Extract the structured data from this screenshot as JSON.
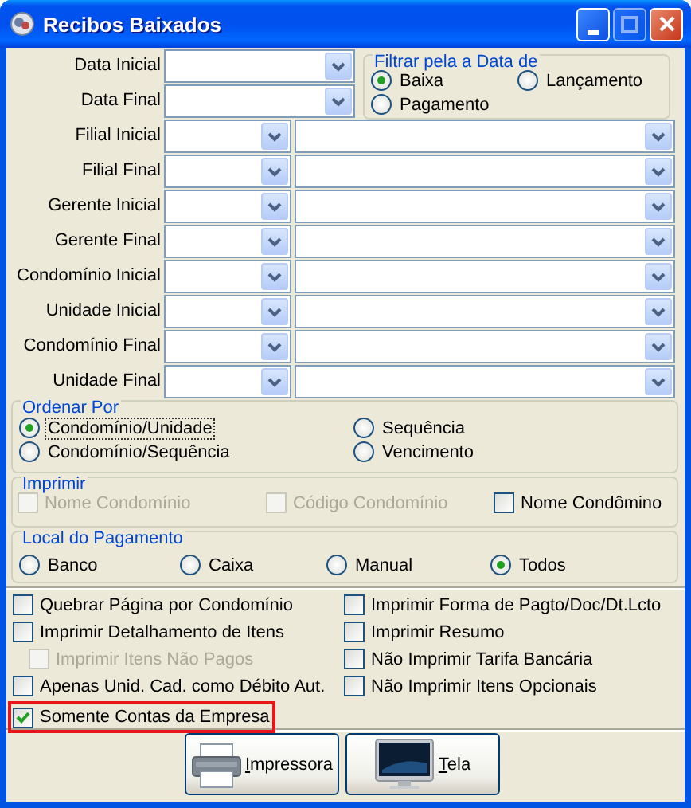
{
  "window": {
    "title": "Recibos Baixados"
  },
  "date_fields": [
    {
      "label": "Data Inicial"
    },
    {
      "label": "Data Final"
    }
  ],
  "date_filter": {
    "title": "Filtrar pela a Data de",
    "options": [
      {
        "label": "Baixa",
        "selected": true
      },
      {
        "label": "Lançamento",
        "selected": false
      },
      {
        "label": "Pagamento",
        "selected": false
      }
    ]
  },
  "range_fields": [
    {
      "label": "Filial Inicial"
    },
    {
      "label": "Filial Final"
    },
    {
      "label": "Gerente Inicial"
    },
    {
      "label": "Gerente Final"
    },
    {
      "label": "Condomínio Inicial"
    },
    {
      "label": "Unidade Inicial"
    },
    {
      "label": "Condomínio Final"
    },
    {
      "label": "Unidade Final"
    }
  ],
  "sort": {
    "title": "Ordenar Por",
    "options": [
      {
        "label": "Condomínio/Unidade",
        "selected": true,
        "focused": true
      },
      {
        "label": "Sequência",
        "selected": false,
        "focused": false
      },
      {
        "label": "Condomínio/Sequência",
        "selected": false,
        "focused": false
      },
      {
        "label": "Vencimento",
        "selected": false,
        "focused": false
      }
    ]
  },
  "print": {
    "title": "Imprimir",
    "options": [
      {
        "label": "Nome Condomínio",
        "checked": false,
        "disabled": true
      },
      {
        "label": "Código Condomínio",
        "checked": false,
        "disabled": true
      },
      {
        "label": "Nome Condômino",
        "checked": false,
        "disabled": false
      }
    ]
  },
  "payment_location": {
    "title": "Local do Pagamento",
    "options": [
      {
        "label": "Banco",
        "selected": false
      },
      {
        "label": "Caixa",
        "selected": false
      },
      {
        "label": "Manual",
        "selected": false
      },
      {
        "label": "Todos",
        "selected": true
      }
    ]
  },
  "options_left": [
    {
      "label": "Quebrar Página por Condomínio",
      "checked": false,
      "disabled": false,
      "highlighted": false
    },
    {
      "label": "Imprimir Detalhamento de Itens",
      "checked": false,
      "disabled": false,
      "highlighted": false,
      "children": [
        {
          "label": "Imprimir Itens Não Pagos",
          "checked": false,
          "disabled": true,
          "highlighted": false
        }
      ]
    },
    {
      "label": "Apenas Unid. Cad. como Débito Aut.",
      "checked": false,
      "disabled": false,
      "highlighted": false
    },
    {
      "label": "Somente Contas da Empresa",
      "checked": true,
      "disabled": false,
      "highlighted": true
    }
  ],
  "options_right": [
    {
      "label": "Imprimir Forma de Pagto/Doc/Dt.Lcto",
      "checked": false,
      "disabled": false,
      "highlighted": false
    },
    {
      "label": "Imprimir Resumo",
      "checked": false,
      "disabled": false,
      "highlighted": false
    },
    {
      "label": "Não Imprimir Tarifa Bancária",
      "checked": false,
      "disabled": false,
      "highlighted": false
    },
    {
      "label": "Não Imprimir Itens Opcionais",
      "checked": false,
      "disabled": false,
      "highlighted": false
    }
  ],
  "buttons": [
    {
      "label": "Impressora",
      "kind": "printer"
    },
    {
      "label": "Tela",
      "kind": "monitor"
    }
  ]
}
